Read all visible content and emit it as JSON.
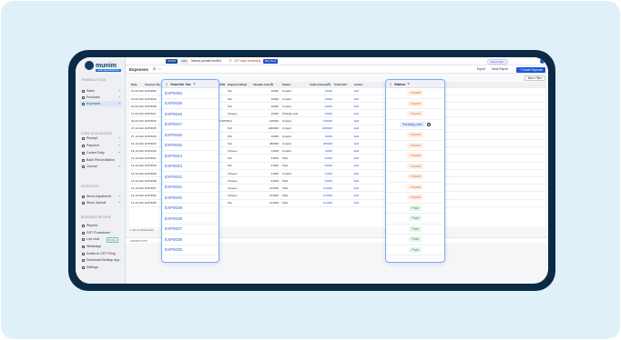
{
  "brand": {
    "name": "munim",
    "tag": "Automated Business"
  },
  "header": {
    "company_id": "GSTIN",
    "chip2": "Mrs",
    "company": "Meera private limited",
    "trial": "207 days remaining",
    "buy": "Buy Now",
    "help": "Need help?"
  },
  "page": {
    "title": "Expenses",
    "report": "Export",
    "more": "More Report",
    "create": "+ Create Expense",
    "more_filter": "More Filter",
    "pagination": "1-10 of 13 Records"
  },
  "sidebar": {
    "sections": [
      "TRANSACTIONS",
      "CORE ACCOUNTING",
      "INVENTORY",
      "BUSINESS REVIEW"
    ],
    "items": [
      {
        "label": "Sales",
        "plus": "+"
      },
      {
        "label": "Purchase",
        "plus": "+"
      },
      {
        "label": "Expenses",
        "plus": "+"
      },
      {
        "label": "Receipt",
        "plus": "+"
      },
      {
        "label": "Payment",
        "plus": "+"
      },
      {
        "label": "Contra Entry",
        "plus": "+"
      },
      {
        "label": "Bank Reconciliation",
        "plus": ""
      },
      {
        "label": "Journal",
        "plus": "+"
      },
      {
        "label": "Stock Adjustment",
        "plus": "+"
      },
      {
        "label": "Stock Journal",
        "plus": "+"
      },
      {
        "label": "Reports",
        "plus": ""
      },
      {
        "label": "GST Procedures",
        "plus": ""
      },
      {
        "label": "Live chat",
        "plus": ""
      },
      {
        "label": "WhatsApp",
        "plus": ""
      },
      {
        "label": "Switch to GST Filing",
        "plus": ""
      },
      {
        "label": "Download Desktop App",
        "plus": ""
      },
      {
        "label": "Settings",
        "plus": ""
      }
    ],
    "online": "Online"
  },
  "shortcuts": "SHORTCUTS",
  "table": {
    "columns": [
      "Date",
      "Voucher No.",
      "Vendor",
      "GSTIN/UIN",
      "Payment Mode",
      "Taxable Amt.(₹)",
      "Status",
      "Total Amount(₹)",
      "Total GST",
      "Action"
    ],
    "rows": [
      [
        "01-03-2023",
        "EXP0050",
        "vxa mart",
        "",
        "N/A",
        "10000",
        "Unpaid",
        "10000",
        "",
        "Edit"
      ],
      [
        "01-03-2023",
        "EXP0049",
        "vxa mart",
        "",
        "N/A",
        "10000",
        "Unpaid",
        "10000",
        "",
        "Edit"
      ],
      [
        "01-03-2023",
        "EXP0048",
        "vxa mart",
        "",
        "N/A",
        "10000",
        "Unpaid",
        "10000",
        "",
        "Edit"
      ],
      [
        "11-03-2023",
        "EXP0047",
        "mart employment",
        "",
        "Cheque",
        "10000",
        "Partially paid",
        "10000",
        "",
        "Edit"
      ],
      [
        "04-03-2023",
        "EXP0046",
        "advance - 2nd - 8th",
        "24AABCS6068M1Z0",
        "N/A",
        "100000",
        "Unpaid",
        "100000",
        "",
        "Edit"
      ],
      [
        "27-12-2024",
        "EXP0045",
        "FAMIL BROS DISTRIBUTORS",
        "",
        "N/A",
        "1000000",
        "Unpaid",
        "1000000",
        "",
        "Edit"
      ],
      [
        "27-12-2024",
        "EXP0044",
        "Lakshmi lal",
        "",
        "N/A",
        "10000",
        "Unpaid",
        "10000",
        "",
        "Edit"
      ],
      [
        "16-12-2024",
        "EXP0043",
        "Lalit soni",
        "",
        "N/A",
        "280000",
        "Unpaid",
        "280000",
        "",
        "Edit"
      ],
      [
        "19-12-2024",
        "EXP0042",
        "Lalit",
        "",
        "Cheque",
        "11000",
        "Unpaid",
        "11000",
        "",
        "Edit"
      ],
      [
        "13-12-2024",
        "EXP0041",
        "vxa mart",
        "",
        "N/A",
        "61000",
        "Paid",
        "61000",
        "",
        "Edit"
      ],
      [
        "13-12-2024",
        "EXP0040",
        "Lakshmi",
        "",
        "N/A",
        "61000",
        "Paid",
        "61000",
        "",
        "Edit"
      ],
      [
        "13-12-2024",
        "EXP0039",
        "Lakshmi",
        "",
        "Cheque",
        "41000",
        "Unpaid",
        "41000",
        "",
        "Edit"
      ],
      [
        "13-12-2024",
        "EXP0038",
        "Lakshmi",
        "",
        "Cheque",
        "91000",
        "Paid",
        "91000",
        "",
        "Edit"
      ],
      [
        "13-12-2024",
        "EXP0037",
        "Lakshmi",
        "",
        "Cheque",
        "101000",
        "Paid",
        "101000",
        "",
        "Edit"
      ],
      [
        "13-12-2024",
        "EXP0036",
        "Lakshmi",
        "",
        "Cheque",
        "101000",
        "Paid",
        "101000",
        "",
        "Edit"
      ],
      [
        "13-12-2024",
        "EXP0035",
        "Lakshmi",
        "",
        "N/A",
        "101000",
        "Paid",
        "101000",
        "",
        "Edit"
      ]
    ]
  },
  "popup_voucher": {
    "title": "Voucher No.",
    "items": [
      "EXP0050",
      "EXP0049",
      "EXP0048",
      "EXP0047",
      "EXP0046",
      "EXP0045",
      "EXP0044",
      "EXP0043",
      "EXP0042",
      "EXP0041",
      "EXP0040",
      "EXP0039",
      "EXP0038",
      "EXP0037",
      "EXP0036",
      "EXP0035"
    ]
  },
  "popup_status": {
    "title": "Status",
    "items": [
      "Unpaid",
      "Unpaid",
      "Unpaid",
      "Partially paid",
      "Unpaid",
      "Unpaid",
      "Unpaid",
      "Unpaid",
      "Unpaid",
      "Unpaid",
      "Unpaid",
      "Paid",
      "Paid",
      "Paid",
      "Paid",
      "Paid"
    ]
  }
}
